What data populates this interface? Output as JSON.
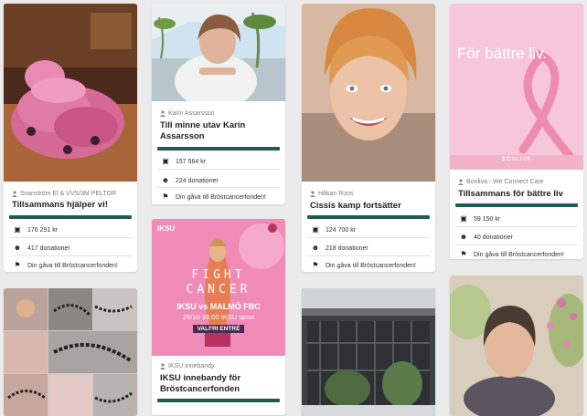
{
  "cards": [
    {
      "organizer": "Svanström El & VVS/3M PELTOR",
      "title": "Tillsammans hjälper vi!",
      "amount": "176 291 kr",
      "donations": "417 donationer",
      "cta": "Din gåva till Bröstcancerfonden!"
    },
    {
      "organizer": "Karin Assarsson",
      "title": "Till minne utav Karin Assarsson",
      "amount": "157 564 kr",
      "donations": "224 donationer",
      "cta": "Din gåva till Bröstcancerfonden!"
    },
    {
      "organizer": "Håkan Roos",
      "title": "Cissis kamp fortsätter",
      "amount": "124 700 kr",
      "donations": "218 donationer",
      "cta": "Din gåva till Bröstcancerfonden!"
    },
    {
      "organizer": "Bonliva - We Connect Care",
      "title": "Tillsammans för bättre liv",
      "amount": "59 150 kr",
      "donations": "40 donationer",
      "cta": "Din gåva till Bröstcancerfonden!",
      "image_text": "För bättre liv.",
      "image_brand": "BONLIVA"
    },
    {
      "organizer": "IKSU innebandy",
      "title": "IKSU innebandy för Bröstcancerfonden",
      "image_logo": "IKSU",
      "image_line1": "FIGHT",
      "image_line2": "CANCER",
      "image_match": "IKSU vs MALMÖ FBC",
      "image_date": "26/10 16:00 IKSU sport",
      "image_entry": "VALFRI ENTRÉ"
    }
  ],
  "colors": {
    "accent": "#1d5c52",
    "background": "#ebebeb",
    "pink": "#f3a6c4"
  },
  "icons": {
    "organizer": "user-icon",
    "amount": "money-icon",
    "donations": "people-icon",
    "cta": "flag-icon"
  }
}
